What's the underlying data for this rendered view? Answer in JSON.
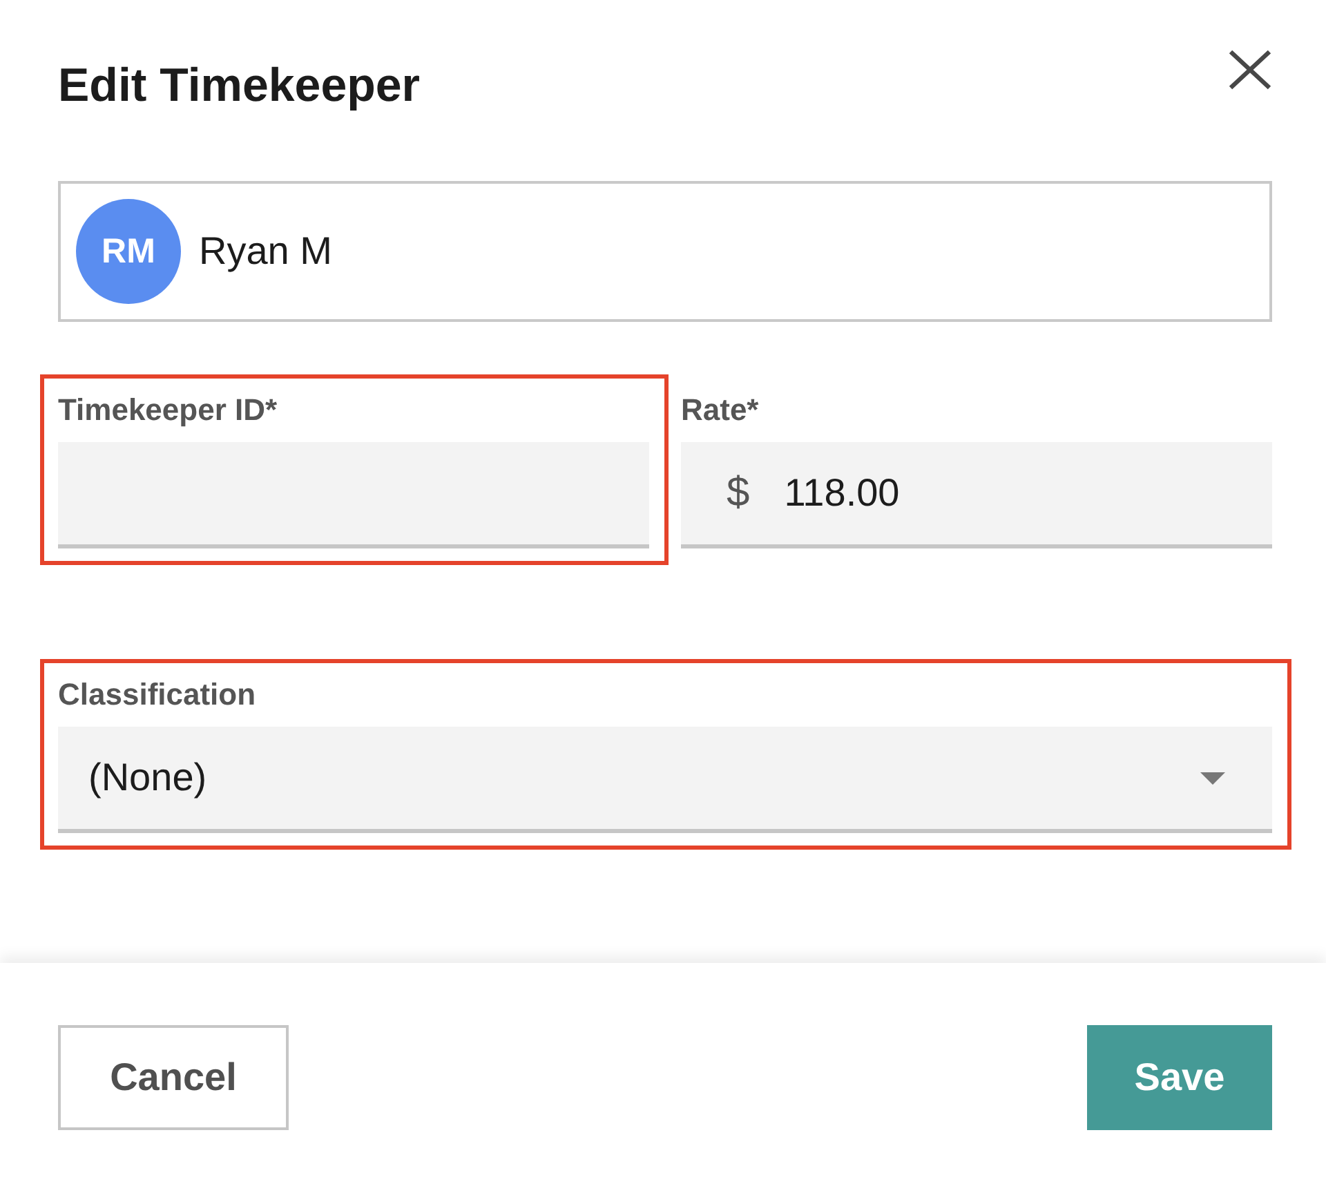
{
  "dialog": {
    "title": "Edit Timekeeper"
  },
  "user": {
    "initials": "RM",
    "name": "Ryan M"
  },
  "rows": [
    {
      "fields": [
        {
          "kind": "text",
          "label": "Timekeeper ID*",
          "highlighted": true
        },
        {
          "kind": "currency",
          "label": "Rate*",
          "prefix": "$",
          "value": "118.00",
          "highlighted": false
        }
      ]
    },
    {
      "fields": [
        {
          "kind": "select",
          "label": "Classification",
          "value": "(None)",
          "highlighted": true
        }
      ]
    }
  ],
  "buttons": [
    {
      "kind": "secondary",
      "label": "Cancel"
    },
    {
      "kind": "primary",
      "label": "Save"
    }
  ]
}
